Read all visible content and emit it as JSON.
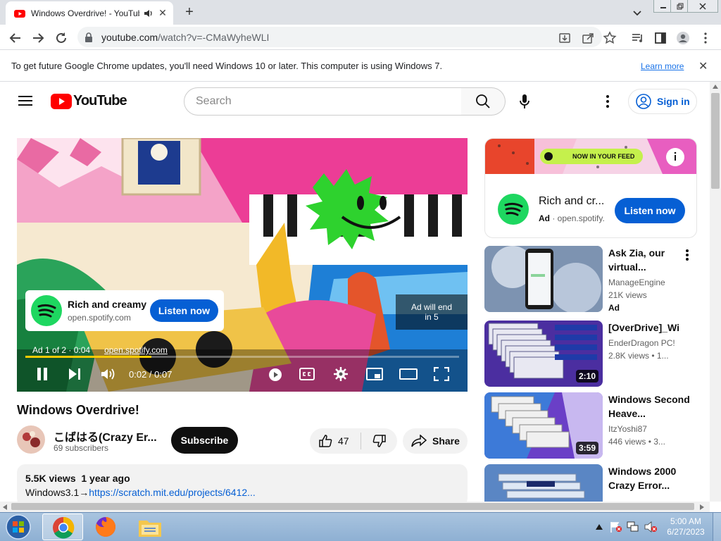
{
  "browser": {
    "tab_title": "Windows Overdrive! - YouTube",
    "url_host": "youtube.com",
    "url_path": "/watch?v=-CMaWyheWLI",
    "new_tab_symbol": "+",
    "close_symbol": "✕"
  },
  "infobar": {
    "message": "To get future Google Chrome updates, you'll need Windows 10 or later. This computer is using Windows 7.",
    "learn_more": "Learn more",
    "close_symbol": "✕"
  },
  "youtube": {
    "logo_text": "YouTube",
    "search_placeholder": "Search",
    "sign_in": "Sign in"
  },
  "player": {
    "ad_title": "Rich and creamy",
    "ad_domain": "open.spotify.com",
    "ad_cta": "Listen now",
    "ad_skip": "Ad will end in 5",
    "ad_info": "Ad 1 of 2 · 0:04",
    "ad_link": "open.spotify.com",
    "time": "0:02 / 0:07",
    "progress": 0.29
  },
  "video": {
    "title": "Windows Overdrive!",
    "channel": "こばはる(Crazy Er...",
    "subscribers": "69 subscribers",
    "subscribe": "Subscribe",
    "likes": "47",
    "share": "Share",
    "views_line": "5.5K views  1 year ago",
    "desc_prefix": "Windows3.1→",
    "desc_link": "https://scratch.mit.edu/projects/6412..."
  },
  "sidebar_ad": {
    "banner_text": "NOW IN YOUR FEED",
    "title": "Rich and cr...",
    "ad_label": "Ad",
    "domain": "· open.spotify.",
    "cta": "Listen now"
  },
  "recommendations": [
    {
      "title": "Ask Zia, our virtual...",
      "channel": "ManageEngine",
      "meta": "21K views",
      "badge": "Ad",
      "duration": ""
    },
    {
      "title": "[OverDrive]_Win",
      "channel": "EnderDragon PC!",
      "meta": "2.8K views  • 1...",
      "badge": "",
      "duration": "2:10"
    },
    {
      "title": "Windows Second Heave...",
      "channel": "ItzYoshi87",
      "meta": "446 views  • 3...",
      "badge": "",
      "duration": "3:59"
    },
    {
      "title": "Windows 2000 Crazy Error...",
      "channel": "",
      "meta": "",
      "badge": "",
      "duration": ""
    }
  ],
  "taskbar": {
    "time": "5:00 AM",
    "date": "6/27/2023"
  },
  "colors": {
    "youtube_red": "#ff0000",
    "link_blue": "#065fd4",
    "spotify_green": "#1ed760"
  }
}
